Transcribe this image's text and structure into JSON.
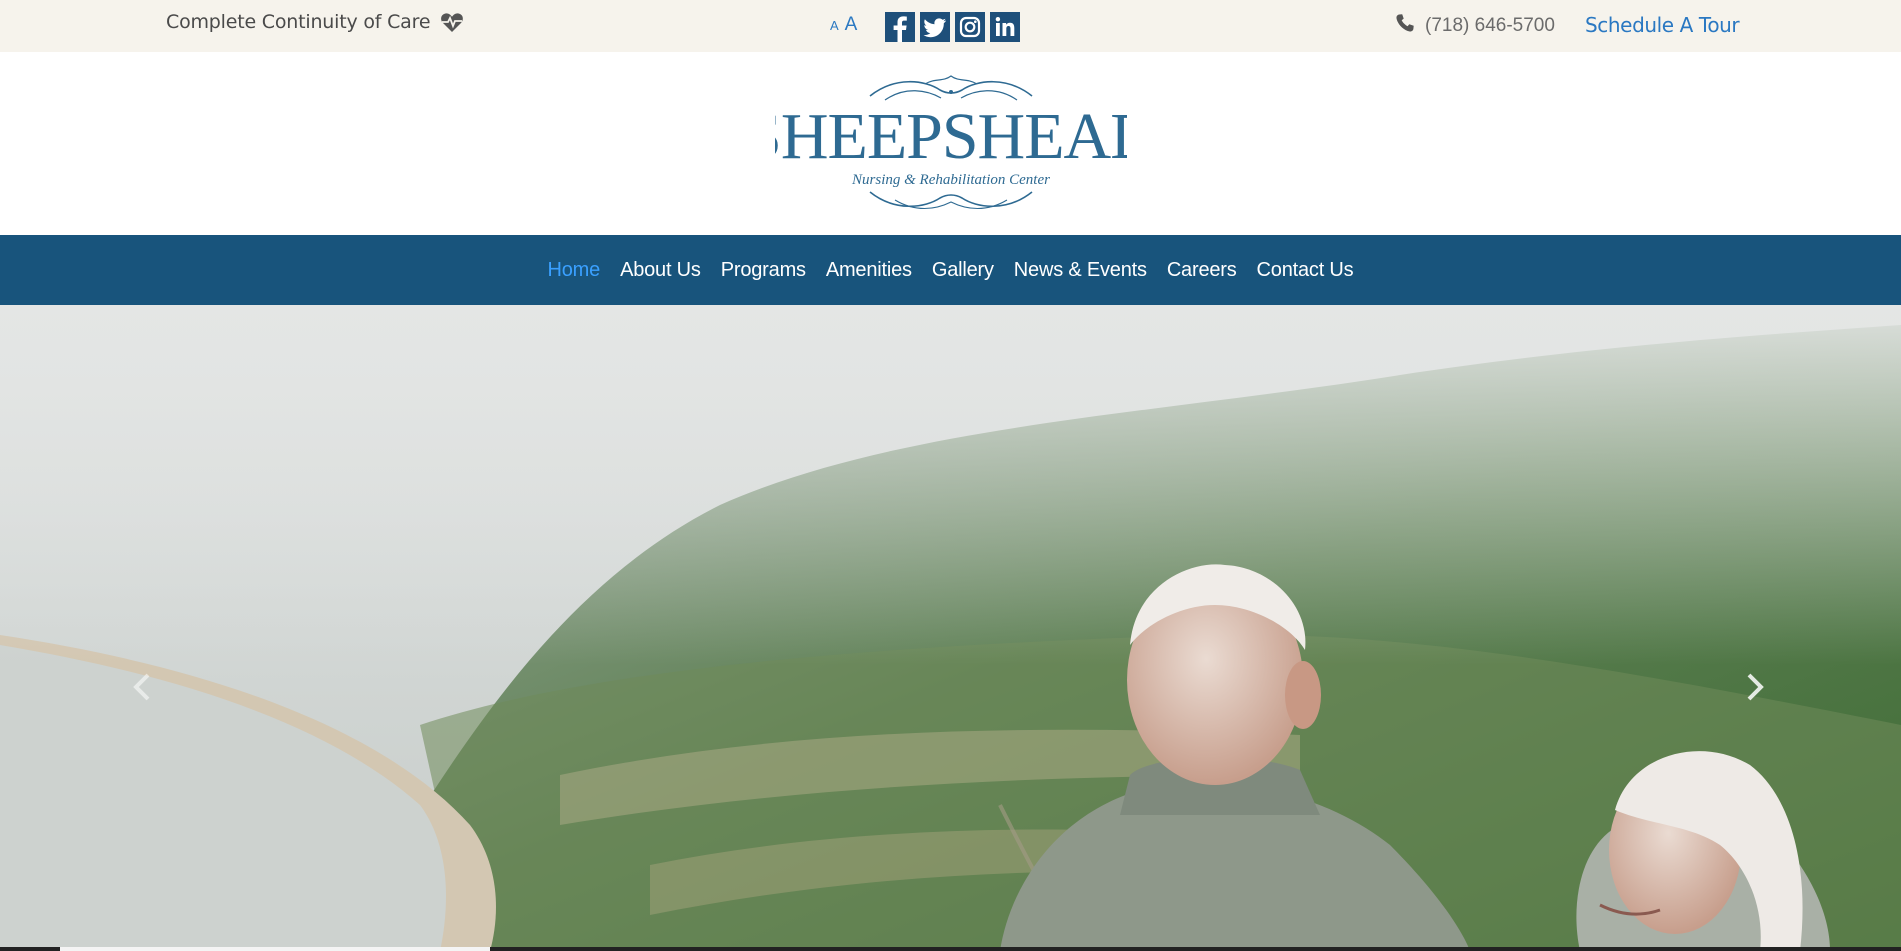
{
  "topbar": {
    "tagline": "Complete Continuity of Care",
    "font_small": "A",
    "font_large": "A",
    "social": [
      "facebook-icon",
      "twitter-icon",
      "instagram-icon",
      "linkedin-icon"
    ],
    "phone": "(718) 646-5700",
    "tour_label": "Schedule A Tour"
  },
  "logo": {
    "name": "SHEEPSHEAD",
    "subtitle": "Nursing & Rehabilitation Center"
  },
  "nav": {
    "items": [
      "Home",
      "About Us",
      "Programs",
      "Amenities",
      "Gallery",
      "News & Events",
      "Careers",
      "Contact Us"
    ],
    "active_index": 0
  },
  "hero": {
    "prev_icon": "chevron-left-icon",
    "next_icon": "chevron-right-icon"
  },
  "colors": {
    "topbar_bg": "#f6f3ec",
    "nav_bg": "#18547c",
    "accent": "#2a78c2",
    "logo_blue": "#2e6a92"
  }
}
